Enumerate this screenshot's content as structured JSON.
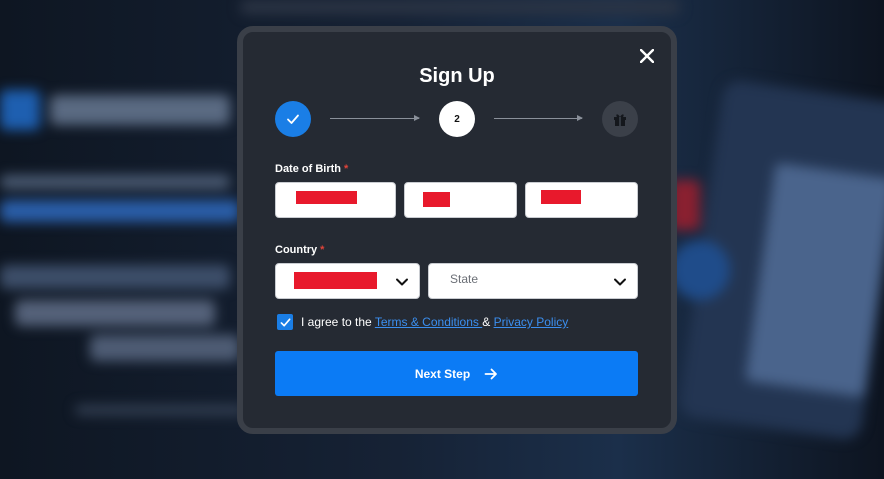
{
  "modal": {
    "title": "Sign Up",
    "close_icon": "close-icon"
  },
  "stepper": {
    "steps": [
      {
        "state": "completed",
        "icon": "check-icon"
      },
      {
        "state": "current",
        "label": "2"
      },
      {
        "state": "upcoming",
        "icon": "gift-icon"
      }
    ]
  },
  "dob": {
    "label": "Date of Birth",
    "required_mark": "*"
  },
  "country": {
    "label": "Country",
    "required_mark": "*",
    "state_placeholder": "State"
  },
  "agreement": {
    "prefix": "I agree to the ",
    "terms_link": "Terms & Conditions ",
    "joiner": " & ",
    "privacy_link": "Privacy Policy",
    "checked": true
  },
  "next_button": {
    "label": "Next Step"
  },
  "colors": {
    "accent": "#0b7bf5",
    "modal_bg": "#252a33",
    "link": "#3b8ff0",
    "required": "#e0443a",
    "redaction": "#e8192c"
  }
}
